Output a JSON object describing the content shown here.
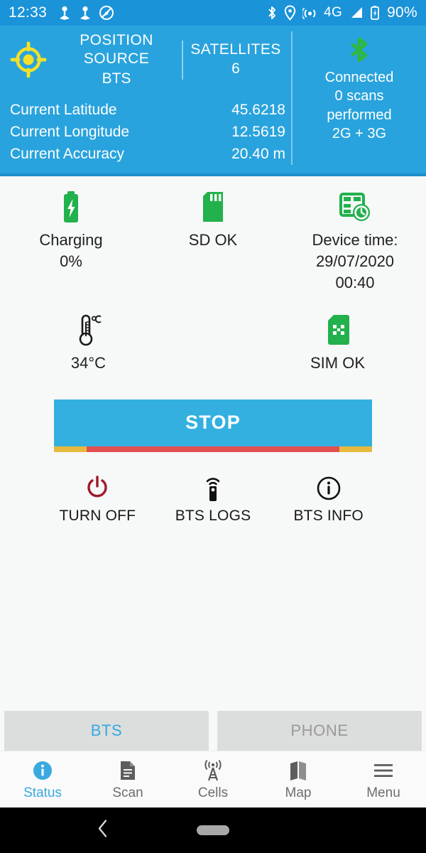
{
  "statusbar": {
    "clock": "12:33",
    "left_icons": [
      "location-pin-icon",
      "location-pin-icon",
      "location-disabled-icon"
    ],
    "right_icons": [
      "bluetooth-icon",
      "location-icon",
      "hotspot-icon"
    ],
    "network_type": "4G",
    "battery_percent": "90%"
  },
  "header": {
    "position_source_label": "POSITION SOURCE",
    "position_source_value": "BTS",
    "satellites_label": "SATELLITES",
    "satellites_value": "6",
    "coords": [
      {
        "label": "Current Latitude",
        "value": "45.6218"
      },
      {
        "label": "Current Longitude",
        "value": "12.5619"
      },
      {
        "label": "Current Accuracy",
        "value": "20.40 m"
      }
    ],
    "bluetooth": {
      "icon": "bluetooth-icon",
      "status": "Connected",
      "scans": "0 scans",
      "scans_cont": "performed",
      "bands": "2G + 3G"
    },
    "bg_color": "#29a3dd",
    "gps_icon_color": "#f2e02a"
  },
  "tiles": {
    "row1": [
      {
        "icon": "battery-charging-icon",
        "label_line1": "Charging",
        "label_line2": "0%",
        "color": "#22b14c"
      },
      {
        "icon": "sd-card-icon",
        "label_line1": "SD OK",
        "label_line2": "",
        "color": "#22b14c"
      },
      {
        "icon": "device-time-icon",
        "label_line1": "Device time:",
        "label_line2": "29/07/2020",
        "label_line3": "00:40",
        "color": "#22b14c"
      }
    ],
    "row2": [
      {
        "icon": "thermometer-icon",
        "label_line1": "34°C",
        "color": "#1b1b1b"
      },
      {
        "icon": "sim-card-icon",
        "label_line1": "SIM OK",
        "color": "#22b14c"
      }
    ]
  },
  "stop_button": {
    "label": "STOP",
    "bg_color": "#33b0e0",
    "bar_outer_color": "#e8b93f",
    "bar_inner_color": "#e0504f"
  },
  "actions": [
    {
      "icon": "power-off-icon",
      "label": "TURN OFF",
      "color": "#9e1b2a"
    },
    {
      "icon": "bts-logs-icon",
      "label": "BTS LOGS",
      "color": "#111111"
    },
    {
      "icon": "info-circle-icon",
      "label": "BTS INFO",
      "color": "#111111"
    }
  ],
  "segmented_tabs": [
    {
      "label": "BTS",
      "active": true,
      "underline_color": "#2e9fd4"
    },
    {
      "label": "PHONE",
      "active": false,
      "underline_color": "#6d6258"
    }
  ],
  "bottom_nav": [
    {
      "icon": "info-icon",
      "label": "Status",
      "active": true
    },
    {
      "icon": "document-icon",
      "label": "Scan",
      "active": false
    },
    {
      "icon": "cell-tower-icon",
      "label": "Cells",
      "active": false
    },
    {
      "icon": "map-icon",
      "label": "Map",
      "active": false
    },
    {
      "icon": "hamburger-menu-icon",
      "label": "Menu",
      "active": false
    }
  ],
  "system_nav": {
    "back_icon": "chevron-left-icon",
    "home_icon": "home-pill-icon"
  }
}
